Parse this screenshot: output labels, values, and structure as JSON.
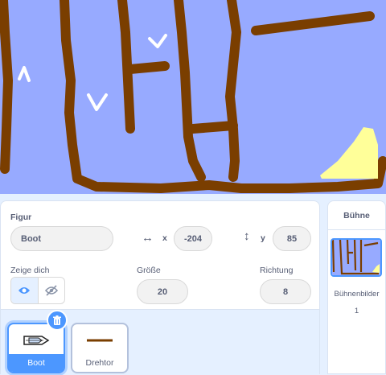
{
  "sprite_info": {
    "sprite_label": "Figur",
    "sprite_name": "Boot",
    "x_label": "x",
    "x_value": "-204",
    "y_label": "y",
    "y_value": "85",
    "show_label": "Zeige dich",
    "size_label": "Größe",
    "size_value": "20",
    "direction_label": "Richtung",
    "direction_value": "8"
  },
  "sprites": [
    {
      "name": "Boot",
      "selected": true
    },
    {
      "name": "Drehtor",
      "selected": false
    }
  ],
  "stage_pane": {
    "title": "Bühne",
    "backdrops_label": "Bühnenbilder",
    "backdrops_count": "1"
  },
  "colors": {
    "accent": "#4c97ff",
    "stage_background": "#97aaff",
    "maze_wall": "#7a3e00",
    "goal_area": "#ffff99"
  },
  "icons": [
    "eye-icon",
    "eye-slash-icon",
    "trash-icon",
    "horizontal-arrows-icon",
    "vertical-arrows-icon"
  ]
}
